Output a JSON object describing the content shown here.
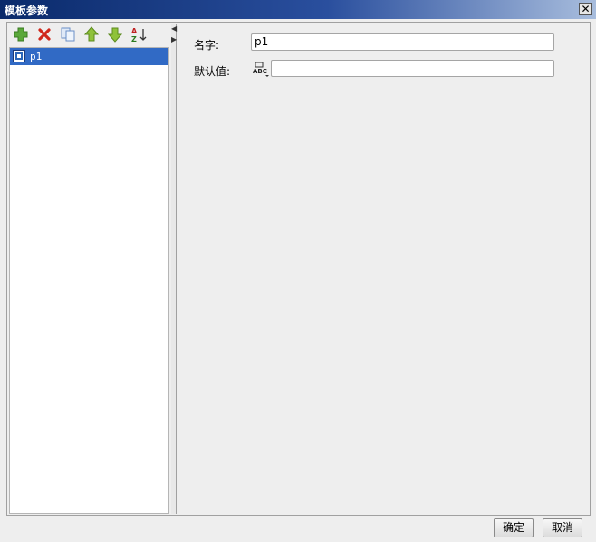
{
  "window": {
    "title": "模板参数"
  },
  "toolbar": {
    "icons": [
      "add-icon",
      "delete-icon",
      "copy-icon",
      "move-up-icon",
      "move-down-icon",
      "sort-az-icon"
    ],
    "colors": {
      "add": "#5aa83a",
      "delete": "#d0281c",
      "arrow": "#8fc23a"
    }
  },
  "params": {
    "items": [
      {
        "label": "p1",
        "selected": true
      }
    ]
  },
  "form": {
    "name_label": "名字:",
    "name_value": "p1",
    "default_label": "默认值:",
    "default_value": ""
  },
  "buttons": {
    "ok": "确定",
    "cancel": "取消"
  },
  "colors": {
    "selection": "#316ac5",
    "title_bar": "#0a2a6b"
  }
}
